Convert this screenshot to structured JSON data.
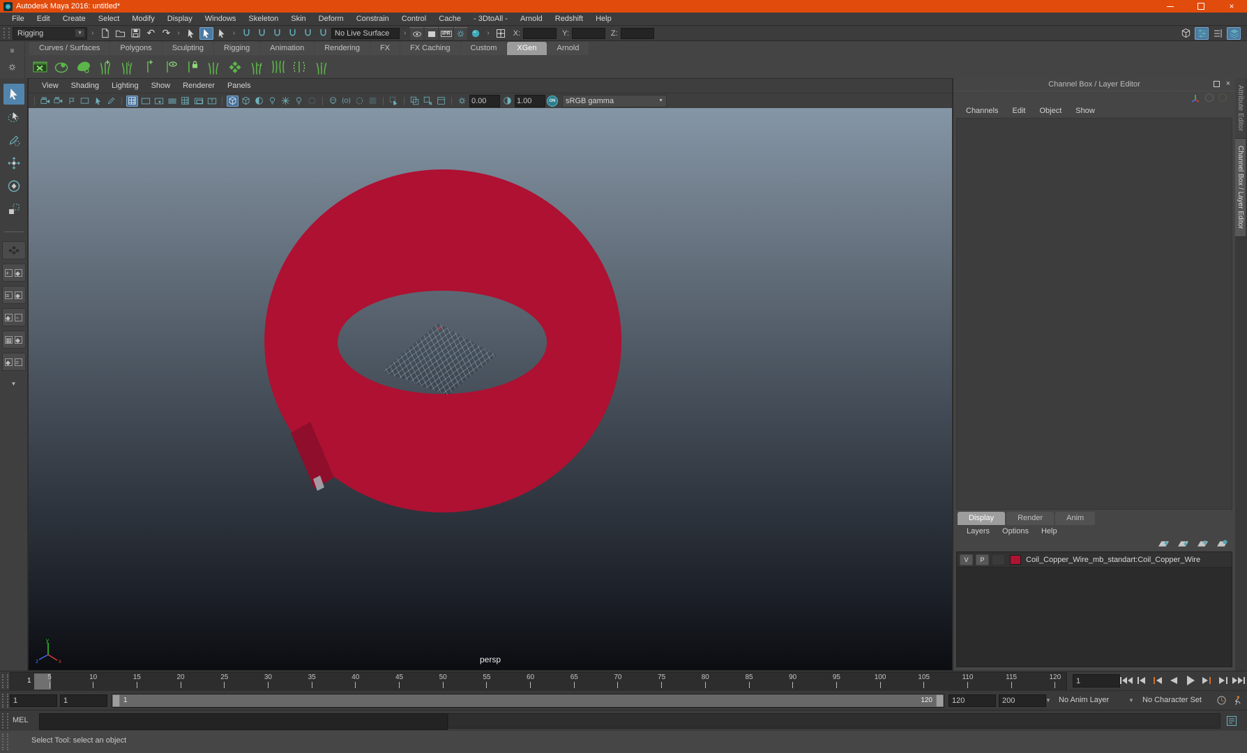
{
  "window": {
    "title": "Autodesk Maya 2016: untitled*"
  },
  "menubar": {
    "items": [
      "File",
      "Edit",
      "Create",
      "Select",
      "Modify",
      "Display",
      "Windows",
      "Skeleton",
      "Skin",
      "Deform",
      "Constrain",
      "Control",
      "Cache",
      "- 3DtoAll -",
      "Arnold",
      "Redshift",
      "Help"
    ]
  },
  "statusline": {
    "mode_selector": "Rigging",
    "no_live_surface": "No Live Surface",
    "x_label": "X:",
    "y_label": "Y:",
    "z_label": "Z:",
    "ipr_label": "IPR",
    "icons": [
      "new-scene",
      "open-scene",
      "save-scene",
      "undo",
      "redo",
      "select-by-hierarchy",
      "select-by-object",
      "select-by-component",
      "snap-to-grid",
      "snap-to-curve",
      "snap-to-point",
      "snap-to-projected-center",
      "snap-to-view-plane",
      "make-object-live",
      "render-view",
      "render-current-frame",
      "ipr-render",
      "render-settings",
      "hypershade",
      "coordinate-input"
    ],
    "sidebar_icons": [
      "modeling-toolkit",
      "attribute-editor",
      "tool-settings",
      "channel-box"
    ]
  },
  "shelf": {
    "tabs": [
      "Curves / Surfaces",
      "Polygons",
      "Sculpting",
      "Rigging",
      "Animation",
      "Rendering",
      "FX",
      "FX Caching",
      "Custom",
      "XGen",
      "Arnold"
    ],
    "active_tab": "XGen",
    "icons": [
      "xgen-editor",
      "xgen-description",
      "xgen-collection",
      "xgen-add-curves",
      "xgen-export-curves",
      "xgen-attach-description",
      "xgen-guide-visibility",
      "xgen-lock-guides",
      "xgen-add-guides",
      "xgen-convert-primitives",
      "xgen-width-tool",
      "xgen-clump-tool",
      "xgen-region-tool",
      "xgen-delete-guides"
    ]
  },
  "toolbox": {
    "tools": [
      "select",
      "lasso-select",
      "paint-select",
      "move",
      "rotate",
      "scale"
    ],
    "active_tool": "select",
    "layouts": [
      "single-pane",
      "four-pane",
      "outliner-persp",
      "persp-graph",
      "hypershade-persp",
      "persp-uv"
    ]
  },
  "viewport": {
    "menus": [
      "View",
      "Shading",
      "Lighting",
      "Show",
      "Renderer",
      "Panels"
    ],
    "toolbar_icons": [
      "select-camera",
      "lock-camera",
      "bookmark",
      "image-plane",
      "two-d-pan-zoom",
      "grease-pencil",
      "grid",
      "film-gate",
      "resolution-gate",
      "gate-mask",
      "field-chart",
      "safe-action",
      "safe-title",
      "wireframe",
      "smooth-shade",
      "textured",
      "use-all-lights",
      "shadows",
      "screen-space-ao",
      "motion-blur",
      "use-default-material",
      "xray",
      "wireframe-on-shaded",
      "isolate-select",
      "panel-layout",
      "exposure",
      "contrast"
    ],
    "exposure": "0.00",
    "gamma": "1.00",
    "toggle": "ON",
    "color_management": "sRGB gamma",
    "camera_label": "persp",
    "axis": {
      "x": "x",
      "y": "y",
      "z": "z"
    }
  },
  "channel_box": {
    "title": "Channel Box / Layer Editor",
    "menus": [
      "Channels",
      "Edit",
      "Object",
      "Show"
    ],
    "vertical_tabs": [
      "Attribute Editor",
      "Channel Box / Layer Editor"
    ],
    "active_vertical_tab": "Channel Box / Layer Editor",
    "layer_editor": {
      "tabs": [
        "Display",
        "Render",
        "Anim"
      ],
      "active_tab": "Display",
      "menus": [
        "Layers",
        "Options",
        "Help"
      ],
      "icons": [
        "move-layer-up",
        "move-layer-down",
        "create-empty-layer",
        "create-layer-from-selected"
      ],
      "layer": {
        "visibility": "V",
        "playback": "P",
        "name": "Coil_Copper_Wire_mb_standart:Coil_Copper_Wire",
        "color": "#b01232"
      }
    }
  },
  "timeline": {
    "ticks": [
      "5",
      "10",
      "15",
      "20",
      "25",
      "30",
      "35",
      "40",
      "45",
      "50",
      "55",
      "60",
      "65",
      "70",
      "75",
      "80",
      "85",
      "90",
      "95",
      "100",
      "105",
      "110",
      "115",
      "120"
    ],
    "current_frame": "1",
    "playback": [
      "go-to-start",
      "step-back-frame",
      "step-back-key",
      "play-backwards",
      "play-forwards",
      "step-forward-key",
      "step-forward-frame",
      "go-to-end"
    ]
  },
  "range_slider": {
    "animation_start": "1",
    "playback_start": "1",
    "range_start_label": "1",
    "range_end_label": "120",
    "playback_end": "120",
    "animation_end": "200",
    "anim_layer": "No Anim Layer",
    "character_set": "No Character Set"
  },
  "command_line": {
    "label": "MEL"
  },
  "help_line": {
    "text": "Select Tool: select an object"
  },
  "colors": {
    "titlebar": "#e14b0c",
    "accent_teal": "#62adbb",
    "active_blue": "#4a7aa2",
    "shelf_green": "#5cb54a",
    "ring_red": "#ae1132",
    "viewport_top": "#8496a6",
    "viewport_bottom": "#0b0d11"
  }
}
